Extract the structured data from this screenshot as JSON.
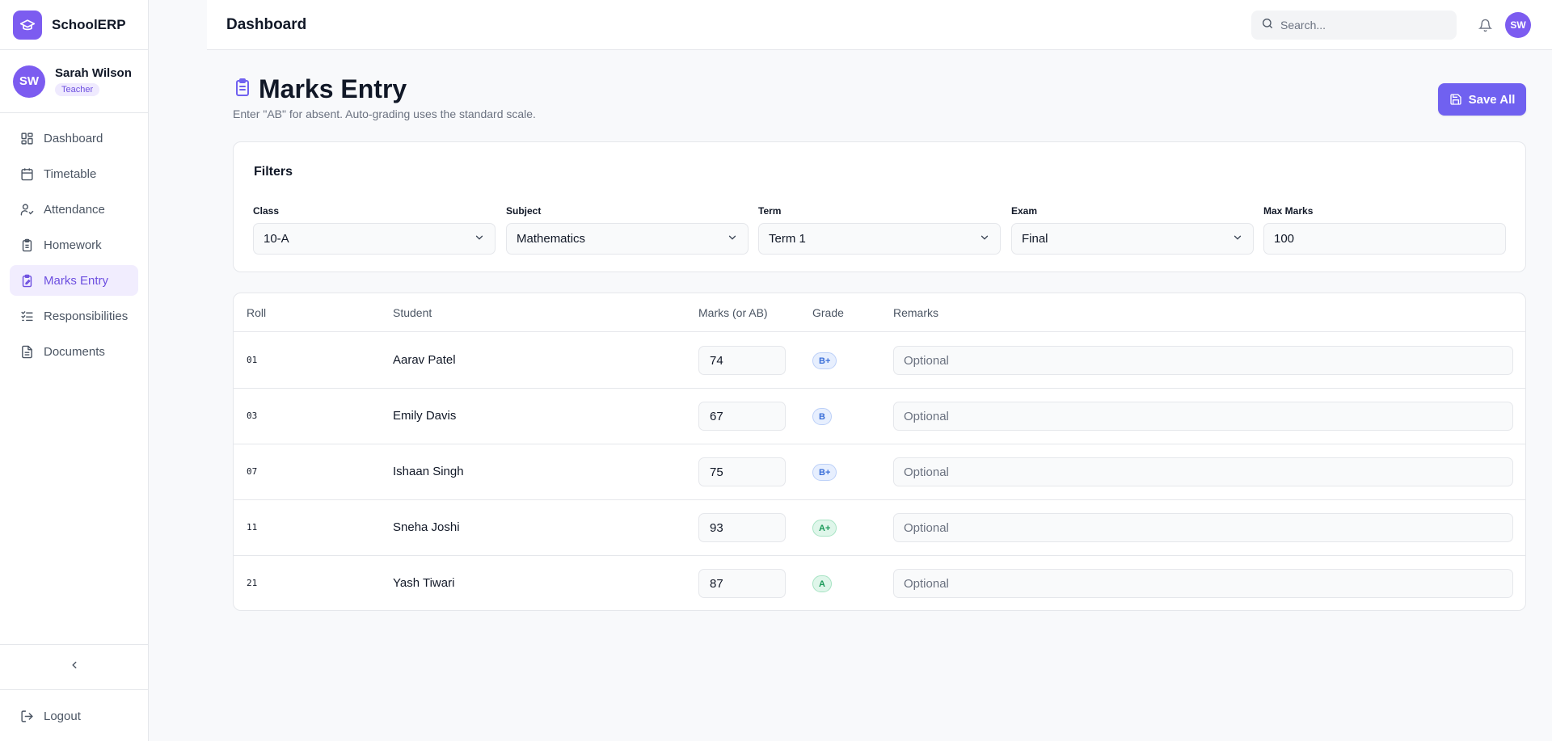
{
  "app": {
    "name": "SchoolERP"
  },
  "user": {
    "name": "Sarah Wilson",
    "initials": "SW",
    "role": "Teacher"
  },
  "sidebar": {
    "items": [
      {
        "label": "Dashboard",
        "icon": "dashboard-icon"
      },
      {
        "label": "Timetable",
        "icon": "calendar-icon"
      },
      {
        "label": "Attendance",
        "icon": "user-check-icon"
      },
      {
        "label": "Homework",
        "icon": "clipboard-icon"
      },
      {
        "label": "Marks Entry",
        "icon": "clipboard-edit-icon",
        "active": true
      },
      {
        "label": "Responsibilities",
        "icon": "list-check-icon"
      },
      {
        "label": "Documents",
        "icon": "document-icon"
      }
    ],
    "logout_label": "Logout"
  },
  "topbar": {
    "title": "Dashboard",
    "search_placeholder": "Search...",
    "avatar_initials": "SW"
  },
  "page": {
    "title": "Marks Entry",
    "subtitle": "Enter \"AB\" for absent. Auto-grading uses the standard scale.",
    "save_label": "Save All"
  },
  "filters": {
    "title": "Filters",
    "class": {
      "label": "Class",
      "value": "10-A"
    },
    "subject": {
      "label": "Subject",
      "value": "Mathematics"
    },
    "term": {
      "label": "Term",
      "value": "Term 1"
    },
    "exam": {
      "label": "Exam",
      "value": "Final"
    },
    "max_marks": {
      "label": "Max Marks",
      "value": "100"
    }
  },
  "table": {
    "columns": {
      "roll": "Roll",
      "student": "Student",
      "marks": "Marks (or AB)",
      "grade": "Grade",
      "remarks": "Remarks"
    },
    "remarks_placeholder": "Optional",
    "rows": [
      {
        "roll": "01",
        "student": "Aarav Patel",
        "marks": "74",
        "grade": "B+"
      },
      {
        "roll": "03",
        "student": "Emily Davis",
        "marks": "67",
        "grade": "B"
      },
      {
        "roll": "07",
        "student": "Ishaan Singh",
        "marks": "75",
        "grade": "B+"
      },
      {
        "roll": "11",
        "student": "Sneha Joshi",
        "marks": "93",
        "grade": "A+"
      },
      {
        "roll": "21",
        "student": "Yash Tiwari",
        "marks": "87",
        "grade": "A"
      }
    ]
  },
  "colors": {
    "accent": "#7061f0",
    "grade_blue": "#3b6fd8",
    "grade_green": "#1c9a5a"
  }
}
